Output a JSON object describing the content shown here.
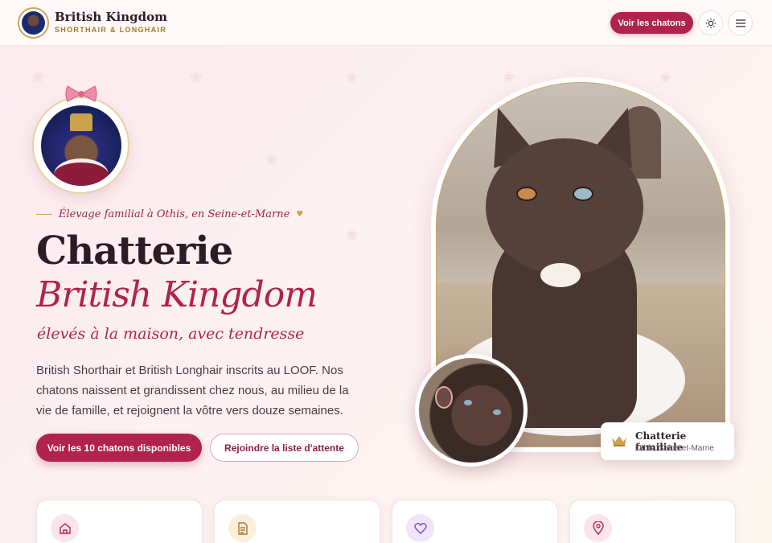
{
  "header": {
    "brand_name": "British Kingdom",
    "brand_sub": "SHORTHAIR & LONGHAIR",
    "cta_label": "Voir les chatons",
    "theme_icon": "sun-icon",
    "menu_icon": "hamburger-icon"
  },
  "hero": {
    "tagline": "Élevage familial à Othis, en Seine-et-Marne",
    "title_line1": "Chatterie",
    "title_line2": "British Kingdom",
    "subtitle": "élevés à la maison, avec tendresse",
    "description": "British Shorthair et British Longhair inscrits au LOOF. Nos chatons naissent et grandissent chez nous, au milieu de la vie de famille, et rejoignent la vôtre vers douze semaines.",
    "primary_button": "Voir les 10 chatons disponibles",
    "secondary_button": "Rejoindre la liste d'attente"
  },
  "badge": {
    "title": "Chatterie familiale",
    "subtitle": "Othis, Seine-et-Marne",
    "icon": "crown-icon"
  },
  "cards": [
    {
      "icon": "home-icon",
      "color": "#fbe4ec"
    },
    {
      "icon": "document-icon",
      "color": "#fbf0dc"
    },
    {
      "icon": "heart-icon",
      "color": "#f0e6fb"
    },
    {
      "icon": "location-pin-icon",
      "color": "#fbe4ec"
    }
  ],
  "colors": {
    "accent": "#b0234e",
    "gold": "#c9a34a",
    "text": "#2d1c27"
  }
}
